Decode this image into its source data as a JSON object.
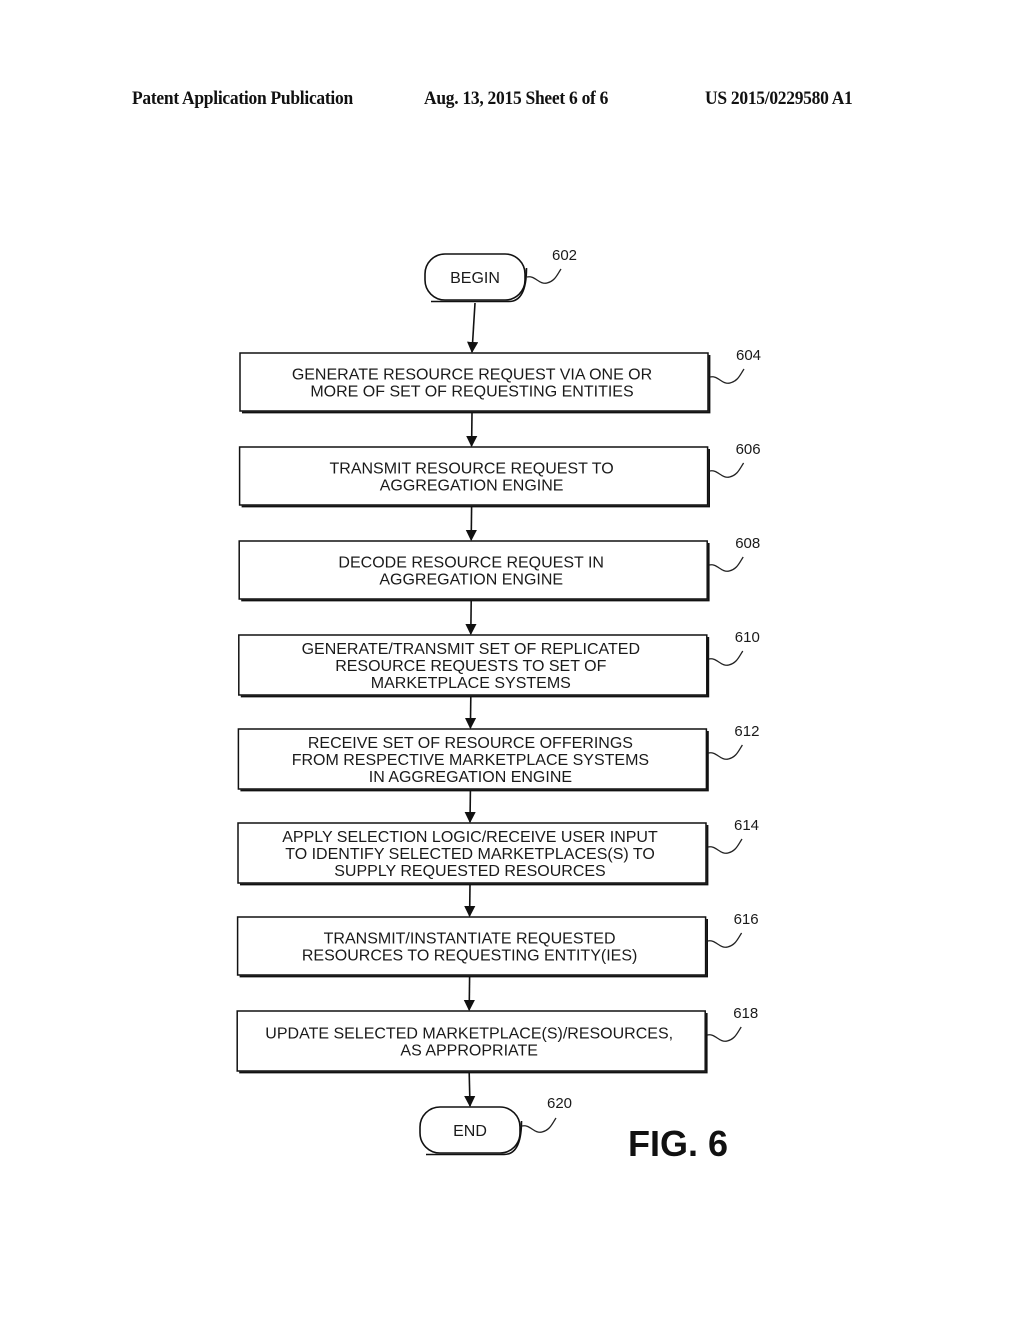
{
  "header": {
    "publication": "Patent Application Publication",
    "date_sheet": "Aug. 13, 2015  Sheet 6 of 6",
    "number": "US 2015/0229580 A1"
  },
  "figure_label": "FIG. 6",
  "flowchart": {
    "begin": {
      "label": "BEGIN",
      "ref": "602"
    },
    "steps": [
      {
        "ref": "604",
        "lines": [
          "GENERATE RESOURCE REQUEST VIA ONE OR",
          "MORE OF SET OF REQUESTING ENTITIES"
        ]
      },
      {
        "ref": "606",
        "lines": [
          "TRANSMIT RESOURCE REQUEST TO",
          "AGGREGATION ENGINE"
        ]
      },
      {
        "ref": "608",
        "lines": [
          "DECODE RESOURCE REQUEST IN",
          "AGGREGATION ENGINE"
        ]
      },
      {
        "ref": "610",
        "lines": [
          "GENERATE/TRANSMIT SET OF REPLICATED",
          "RESOURCE REQUESTS TO SET OF",
          "MARKETPLACE SYSTEMS"
        ]
      },
      {
        "ref": "612",
        "lines": [
          "RECEIVE SET OF RESOURCE OFFERINGS",
          "FROM RESPECTIVE MARKETPLACE SYSTEMS",
          "IN AGGREGATION ENGINE"
        ]
      },
      {
        "ref": "614",
        "lines": [
          "APPLY SELECTION LOGIC/RECEIVE USER INPUT",
          "TO IDENTIFY SELECTED MARKETPLACES(S) TO",
          "SUPPLY REQUESTED RESOURCES"
        ]
      },
      {
        "ref": "616",
        "lines": [
          "TRANSMIT/INSTANTIATE REQUESTED",
          "RESOURCES TO REQUESTING ENTITY(IES)"
        ]
      },
      {
        "ref": "618",
        "lines": [
          "UPDATE SELECTED MARKETPLACE(S)/RESOURCES,",
          "AS APPROPRIATE"
        ]
      }
    ],
    "end": {
      "label": "END",
      "ref": "620"
    }
  }
}
